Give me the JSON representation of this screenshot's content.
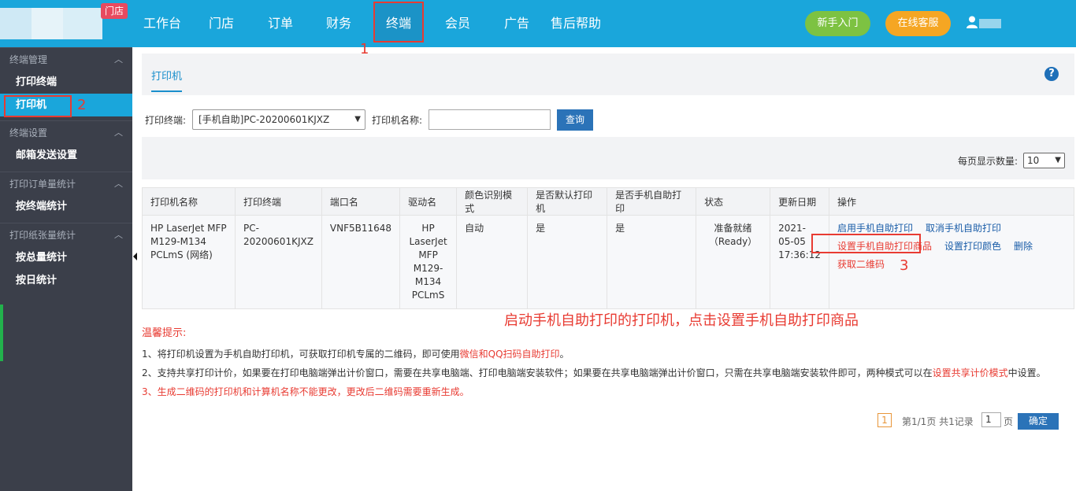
{
  "header": {
    "store_badge": "门店",
    "nav": [
      "工作台",
      "门店",
      "订单",
      "财务",
      "终端",
      "会员",
      "广告",
      "售后帮助"
    ],
    "new_user_button": "新手入门",
    "online_service_button": "在线客服",
    "annotation_1": "1"
  },
  "sidebar": {
    "groups": [
      {
        "title": "终端管理",
        "items": [
          "打印终端",
          "打印机"
        ]
      },
      {
        "title": "终端设置",
        "items": [
          "邮箱发送设置"
        ]
      },
      {
        "title": "打印订单量统计",
        "items": [
          "按终端统计"
        ]
      },
      {
        "title": "打印纸张量统计",
        "items": [
          "按总量统计",
          "按日统计"
        ]
      }
    ],
    "annotation_2": "2"
  },
  "content": {
    "tab": "打印机",
    "help": "?",
    "filter": {
      "terminal_label": "打印终端:",
      "terminal_value": "[手机自助]PC-20200601KJXZ",
      "printer_name_label": "打印机名称:",
      "query_button": "查询"
    },
    "page_size_label": "每页显示数量:",
    "page_size_value": "10",
    "table": {
      "headers": [
        "打印机名称",
        "打印终端",
        "端口名",
        "驱动名",
        "颜色识别模式",
        "是否默认打印机",
        "是否手机自助打印",
        "状态",
        "更新日期",
        "操作"
      ],
      "row": {
        "name": "HP LaserJet MFP M129-M134 PCLmS (网络)",
        "terminal": "PC-20200601KJXZ",
        "port": "VNF5B11648",
        "driver": "HP LaserJet MFP M129-M134 PCLmS",
        "color_mode": "自动",
        "is_default": "是",
        "is_self_print": "是",
        "status": "准备就绪（Ready）",
        "updated": "2021-05-05 17:36:12",
        "ops": {
          "enable": "启用手机自助打印",
          "cancel": "取消手机自助打印",
          "set_goods": "设置手机自助打印商品",
          "set_color": "设置打印颜色",
          "delete": "删除",
          "get_qr": "获取二维码"
        }
      }
    },
    "annotation_3": "3",
    "big_note": "启动手机自助打印的打印机，点击设置手机自助打印商品",
    "tips": {
      "title": "温馨提示:",
      "t1_a": "1、将打印机设置为手机自助打印机，可获取打印机专属的二维码，即可使用",
      "t1_b": "微信和QQ扫码自助打印",
      "t1_c": "。",
      "t2_a": "2、支持共享打印计价，如果要在打印电脑端弹出计价窗口，需要在共享电脑端、打印电脑端安装软件；如果要在共享电脑端弹出计价窗口，只需在共享电脑端安装软件即可，两种模式可以在",
      "t2_b": "设置共享计价模式",
      "t2_c": "中设置。",
      "t3_a": "3、",
      "t3_b": "生成二维码的打印机和计算机名称不能更改，更改后二维码需要重新生成。"
    },
    "pagination": {
      "current": "1",
      "info": "第1/1页 共1记录",
      "input": "1",
      "unit": "页",
      "confirm": "确定"
    }
  }
}
